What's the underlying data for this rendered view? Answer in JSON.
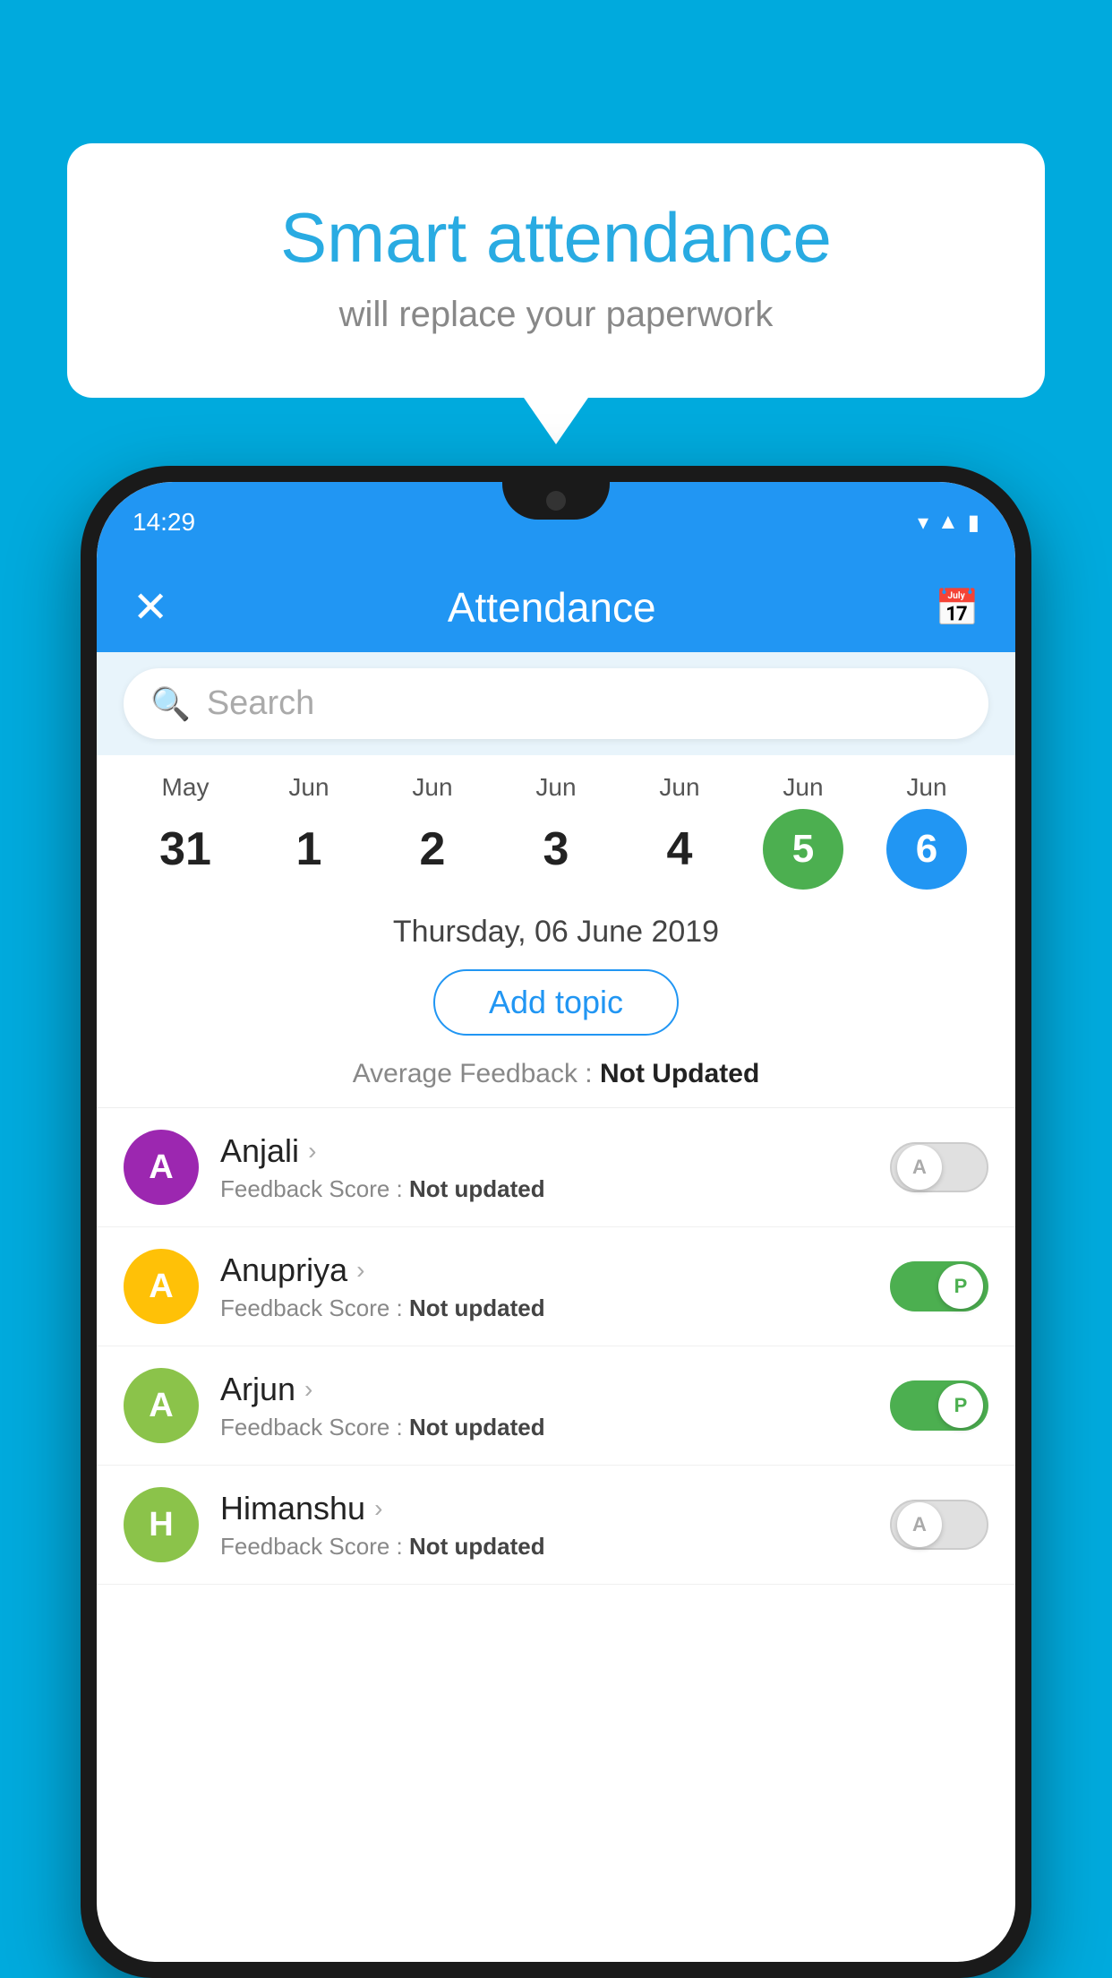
{
  "background_color": "#00AADD",
  "bubble": {
    "title": "Smart attendance",
    "subtitle": "will replace your paperwork"
  },
  "status_bar": {
    "time": "14:29",
    "icons": [
      "wifi",
      "signal",
      "battery"
    ]
  },
  "header": {
    "close_icon": "✕",
    "title": "Attendance",
    "calendar_icon": "📅"
  },
  "search": {
    "placeholder": "Search"
  },
  "calendar": {
    "days": [
      {
        "month": "May",
        "num": "31",
        "style": "normal"
      },
      {
        "month": "Jun",
        "num": "1",
        "style": "normal"
      },
      {
        "month": "Jun",
        "num": "2",
        "style": "normal"
      },
      {
        "month": "Jun",
        "num": "3",
        "style": "normal"
      },
      {
        "month": "Jun",
        "num": "4",
        "style": "normal"
      },
      {
        "month": "Jun",
        "num": "5",
        "style": "green"
      },
      {
        "month": "Jun",
        "num": "6",
        "style": "blue"
      }
    ],
    "selected_date": "Thursday, 06 June 2019"
  },
  "add_topic_label": "Add topic",
  "avg_feedback_label": "Average Feedback :",
  "avg_feedback_value": "Not Updated",
  "students": [
    {
      "name": "Anjali",
      "avatar_letter": "A",
      "avatar_color": "#9C27B0",
      "feedback": "Not updated",
      "toggle_state": "off",
      "toggle_label": "A"
    },
    {
      "name": "Anupriya",
      "avatar_letter": "A",
      "avatar_color": "#FFC107",
      "feedback": "Not updated",
      "toggle_state": "on",
      "toggle_label": "P"
    },
    {
      "name": "Arjun",
      "avatar_letter": "A",
      "avatar_color": "#8BC34A",
      "feedback": "Not updated",
      "toggle_state": "on",
      "toggle_label": "P"
    },
    {
      "name": "Himanshu",
      "avatar_letter": "H",
      "avatar_color": "#8BC34A",
      "feedback": "Not updated",
      "toggle_state": "off",
      "toggle_label": "A"
    }
  ],
  "labels": {
    "feedback_score_prefix": "Feedback Score :"
  }
}
